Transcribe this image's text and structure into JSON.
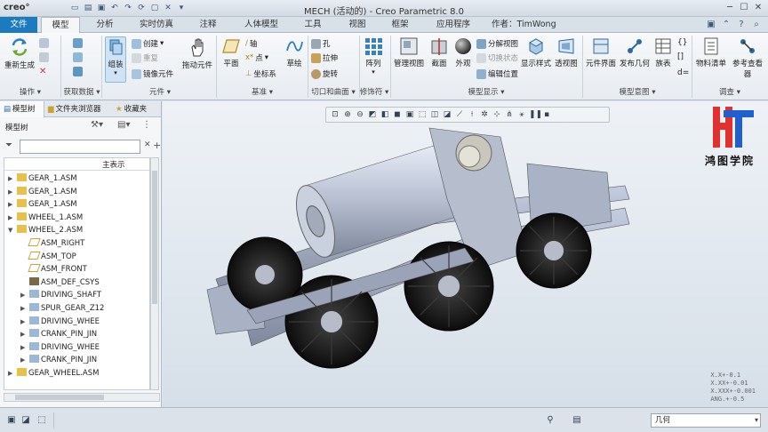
{
  "titlebar": {
    "logo": "creo°",
    "title": "MECH (活动的) - Creo Parametric 8.0",
    "window_controls": [
      "minimize",
      "maximize",
      "close"
    ]
  },
  "tabs": {
    "file": "文件",
    "items": [
      "模型",
      "分析",
      "实时仿真",
      "注释",
      "人体模型",
      "工具",
      "视图",
      "框架",
      "应用程序"
    ],
    "active": "模型",
    "author": "作者：TimWong"
  },
  "ribbon": {
    "operations": {
      "regenerate": "重新生成",
      "label": "操作"
    },
    "get_data": {
      "label": "获取数据"
    },
    "component": {
      "assemble": "组装",
      "create": "创建",
      "repeat": "重复",
      "mirror": "镜像元件",
      "drag": "拖动元件",
      "label": "元件"
    },
    "datum": {
      "plane": "平面",
      "axis": "轴",
      "point": "点",
      "csys": "坐标系",
      "sketch": "草绘",
      "label": "基准"
    },
    "cut_surface": {
      "hole": "孔",
      "extrude": "拉伸",
      "revolve": "旋转",
      "label": "切口和曲面"
    },
    "modifiers": {
      "pattern": "阵列",
      "label": "修饰符"
    },
    "model_display": {
      "manage_views": "管理视图",
      "section": "截面",
      "appearance": "外观",
      "explode_view": "分解视图",
      "toggle_status": "切换状态",
      "edit_position": "编辑位置",
      "display_style": "显示样式",
      "perspective": "透视图",
      "label": "模型显示"
    },
    "model_intent": {
      "component_interface": "元件界面",
      "publish_geometry": "发布几何",
      "family_table": "族表",
      "label": "模型意图"
    },
    "investigate": {
      "bom": "物料清单",
      "reference_viewer": "参考查看器",
      "label": "调查"
    }
  },
  "left_panel": {
    "tabs": [
      "模型树",
      "文件夹浏览器",
      "收藏夹"
    ],
    "header": "模型树",
    "column": "主表示",
    "tree": [
      {
        "label": "GEAR_1.ASM",
        "level": 0,
        "expander": "▶",
        "kind": "asm"
      },
      {
        "label": "GEAR_1.ASM",
        "level": 0,
        "expander": "▶",
        "kind": "asm"
      },
      {
        "label": "GEAR_1.ASM",
        "level": 0,
        "expander": "▶",
        "kind": "asm"
      },
      {
        "label": "WHEEL_1.ASM",
        "level": 0,
        "expander": "▶",
        "kind": "asm"
      },
      {
        "label": "WHEEL_2.ASM",
        "level": 0,
        "expander": "▼",
        "kind": "asm"
      },
      {
        "label": "ASM_RIGHT",
        "level": 1,
        "expander": "",
        "kind": "plane"
      },
      {
        "label": "ASM_TOP",
        "level": 1,
        "expander": "",
        "kind": "plane"
      },
      {
        "label": "ASM_FRONT",
        "level": 1,
        "expander": "",
        "kind": "plane"
      },
      {
        "label": "ASM_DEF_CSYS",
        "level": 1,
        "expander": "",
        "kind": "csys"
      },
      {
        "label": "DRIVING_SHAFT",
        "level": 1,
        "expander": "▶",
        "kind": "part"
      },
      {
        "label": "SPUR_GEAR_Z12",
        "level": 1,
        "expander": "▶",
        "kind": "part"
      },
      {
        "label": "DRIVING_WHEE",
        "level": 1,
        "expander": "▶",
        "kind": "part"
      },
      {
        "label": "CRANK_PIN_JIN",
        "level": 1,
        "expander": "▶",
        "kind": "part"
      },
      {
        "label": "DRIVING_WHEE",
        "level": 1,
        "expander": "▶",
        "kind": "part"
      },
      {
        "label": "CRANK_PIN_JIN",
        "level": 1,
        "expander": "▶",
        "kind": "part"
      },
      {
        "label": "GEAR_WHEEL.ASM",
        "level": 0,
        "expander": "▶",
        "kind": "asm"
      }
    ]
  },
  "graphics": {
    "watermark": "鸿图学院",
    "tolerances": [
      "X.X+-0.1",
      "X.XX+-0.01",
      "X.XXX+-0.001",
      "ANG.+-0.5"
    ]
  },
  "status": {
    "selection_filter": "几何"
  }
}
